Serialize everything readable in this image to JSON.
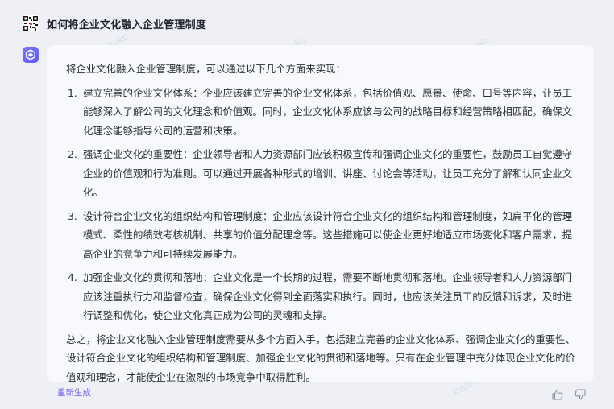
{
  "question": "如何将企业文化融入企业管理制度",
  "answer": {
    "intro": "将企业文化融入企业管理制度，可以通过以下几个方面来实现：",
    "items": [
      {
        "num": "1.",
        "text": "建立完善的企业文化体系：企业应该建立完善的企业文化体系，包括价值观、愿景、使命、口号等内容，让员工能够深入了解公司的文化理念和价值观。同时，企业文化体系应该与公司的战略目标和经营策略相匹配，确保文化理念能够指导公司的运营和决策。"
      },
      {
        "num": "2.",
        "text": "强调企业文化的重要性：企业领导者和人力资源部门应该积极宣传和强调企业文化的重要性，鼓励员工自觉遵守企业的价值观和行为准则。可以通过开展各种形式的培训、讲座、讨论会等活动，让员工充分了解和认同企业文化。"
      },
      {
        "num": "3.",
        "text": "设计符合企业文化的组织结构和管理制度：企业应该设计符合企业文化的组织结构和管理制度，如扁平化的管理模式、柔性的绩效考核机制、共享的价值分配理念等。这些措施可以使企业更好地适应市场变化和客户需求，提高企业的竞争力和可持续发展能力。"
      },
      {
        "num": "4.",
        "text": "加强企业文化的贯彻和落地：企业文化是一个长期的过程，需要不断地贯彻和落地。企业领导者和人力资源部门应该注重执行力和监督检查，确保企业文化得到全面落实和执行。同时，也应该关注员工的反馈和诉求，及时进行调整和优化，使企业文化真正成为公司的灵魂和支撑。"
      }
    ],
    "summary": "总之，将企业文化融入企业管理制度需要从多个方面入手，包括建立完善的企业文化体系、强调企业文化的重要性、设计符合企业文化的组织结构和管理制度、加强企业文化的贯彻和落地等。只有在企业管理中充分体现企业文化的价值观和理念，才能使企业在激烈的市场竞争中取得胜利。"
  },
  "actions": {
    "regenerate": "重新生成",
    "like_icon": "thumbs-up-icon",
    "dislike_icon": "thumbs-down-icon"
  },
  "watermark": "kv8lkukb",
  "colors": {
    "background": "#eef0f6",
    "bubble": "#f8f9fc",
    "accent": "#6b5cff"
  }
}
